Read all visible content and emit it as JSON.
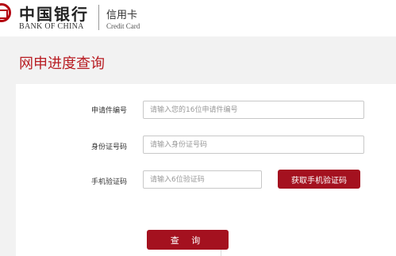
{
  "header": {
    "brand_cn": "中国银行",
    "brand_en": "BANK OF CHINA",
    "product_cn": "信用卡",
    "product_en": "Credit Card"
  },
  "page": {
    "title": "网申进度查询"
  },
  "form": {
    "application_number": {
      "label": "申请件编号",
      "value": "",
      "placeholder": "请输入您的16位申请件编号"
    },
    "id_number": {
      "label": "身份证号码",
      "value": "",
      "placeholder": "请输入身份证号码"
    },
    "sms_code": {
      "label": "手机验证码",
      "value": "",
      "placeholder": "请输入6位验证码"
    },
    "get_code_button": "获取手机验证码",
    "query_button": "查 询"
  },
  "colors": {
    "brand_red": "#b81c22",
    "button_red": "#a4111f"
  }
}
